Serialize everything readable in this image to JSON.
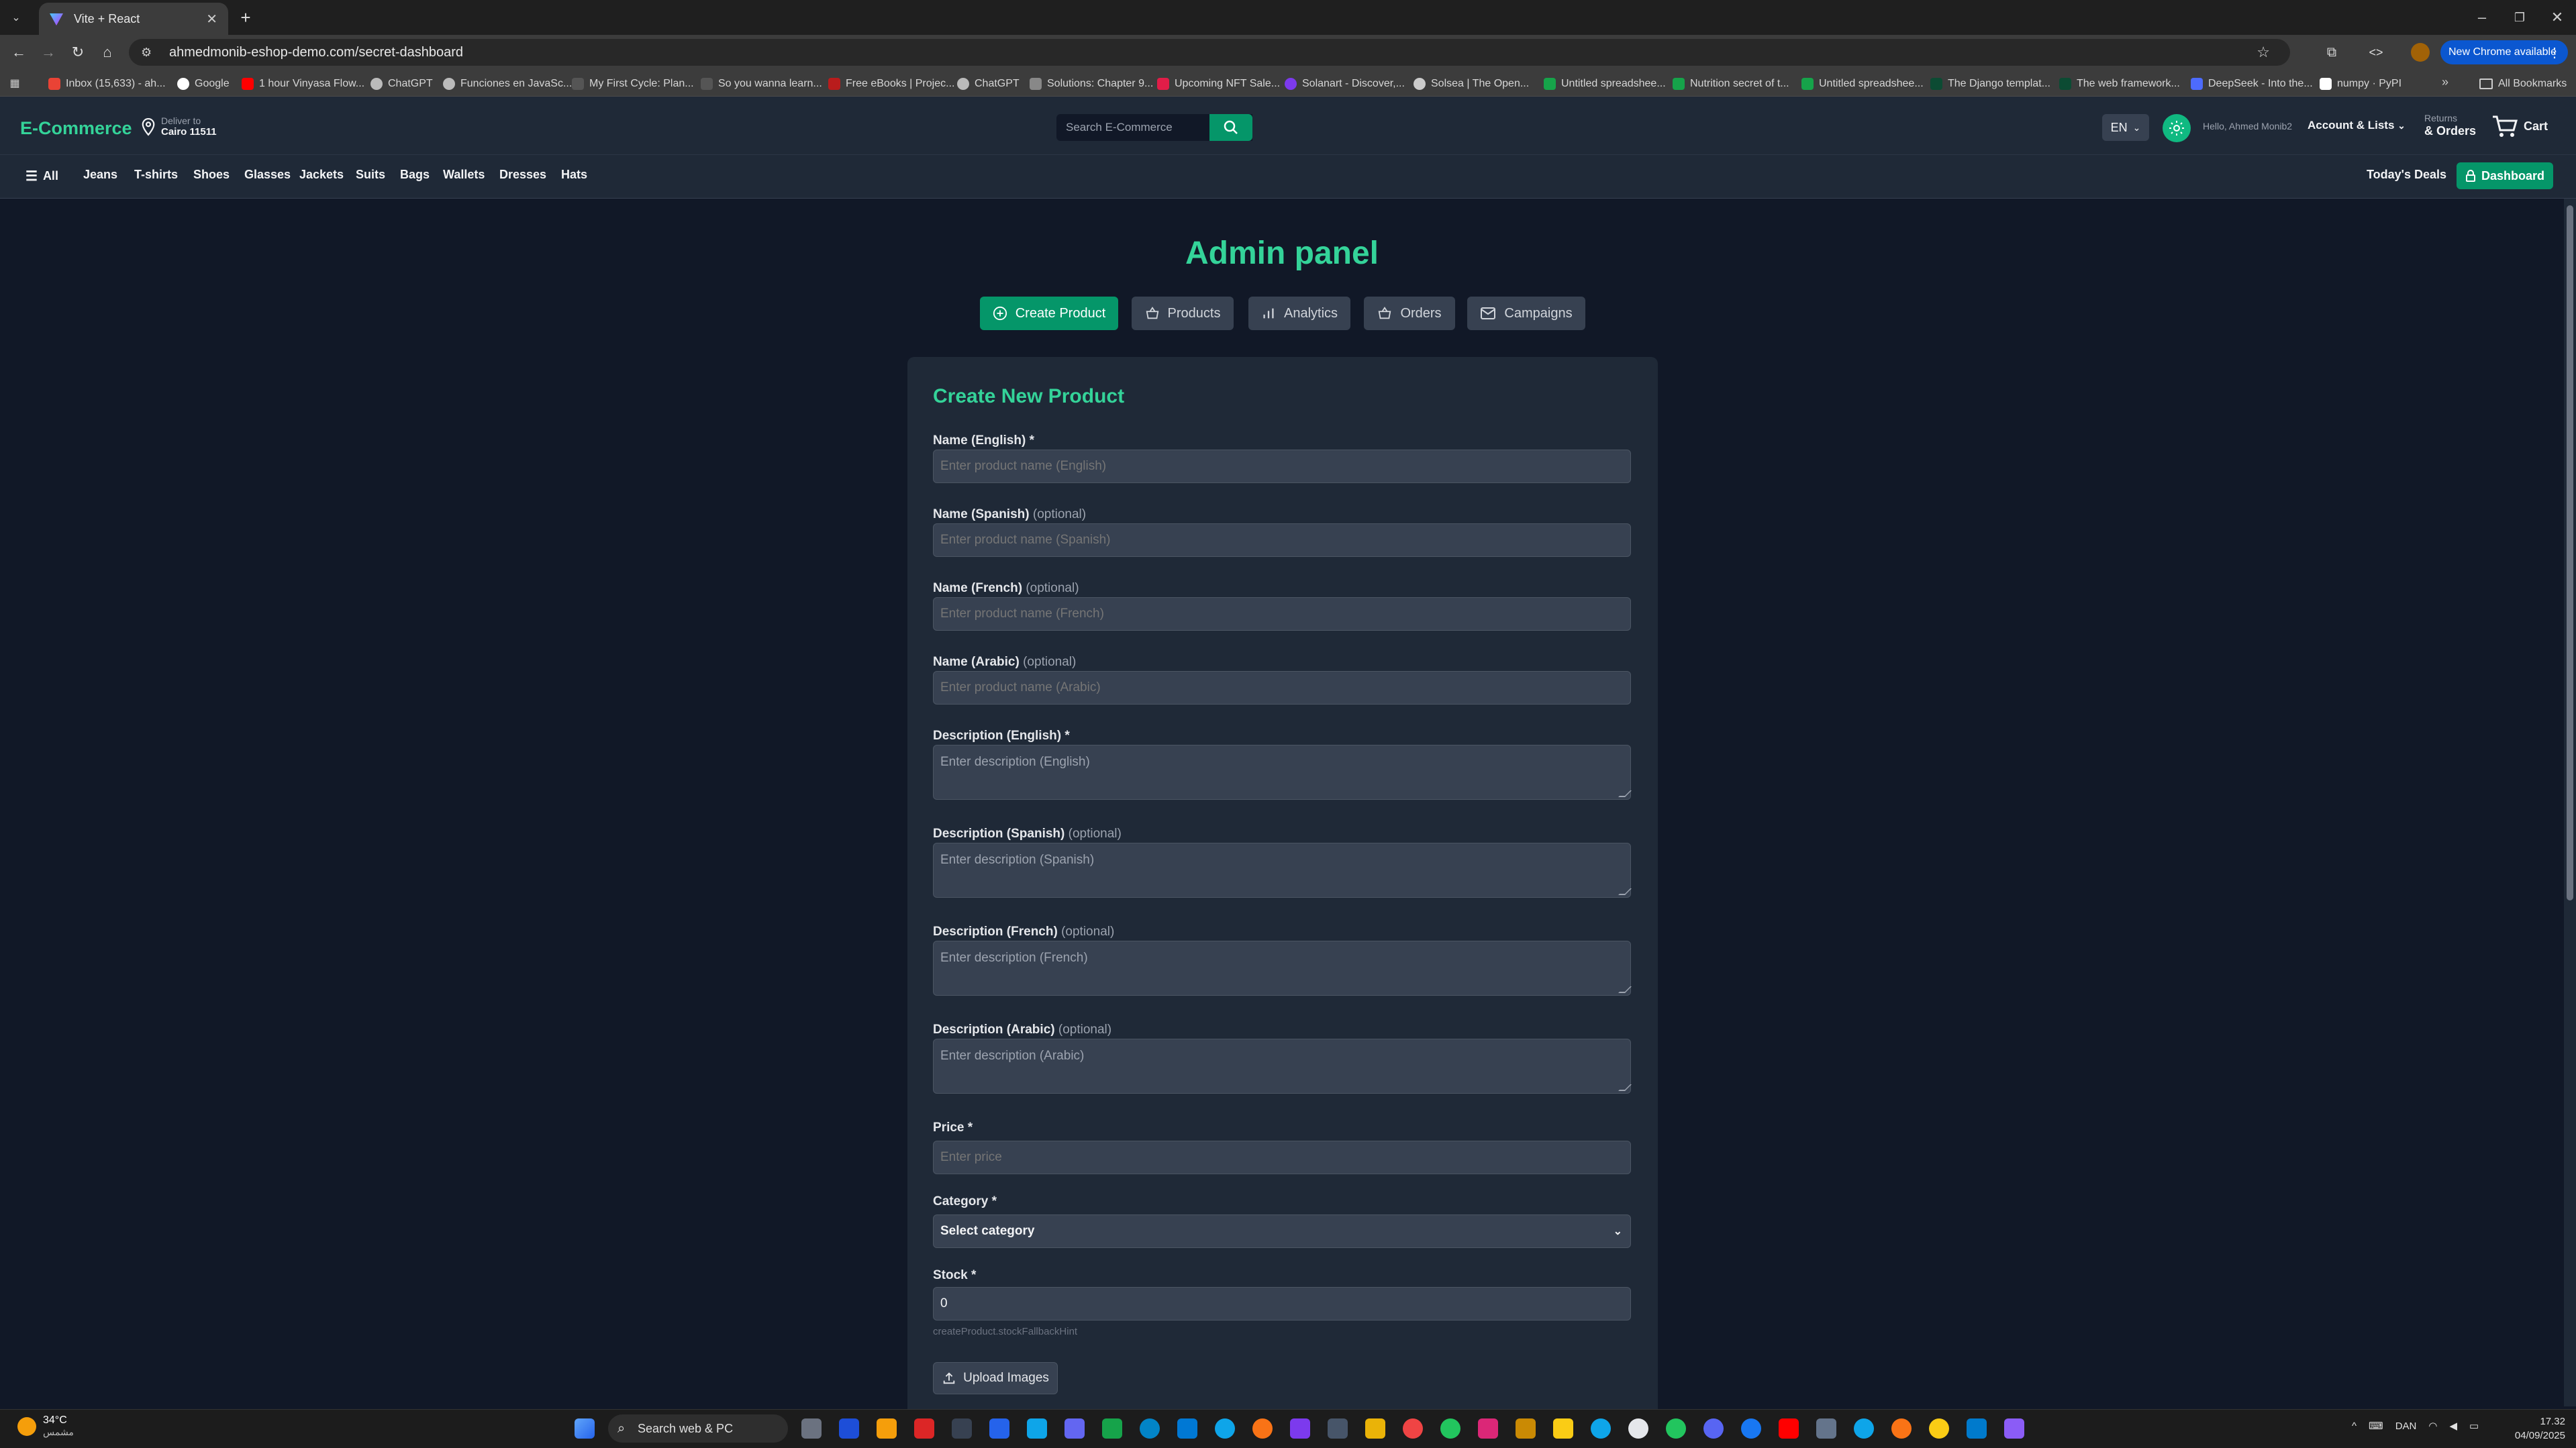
{
  "browser": {
    "tab_title": "Vite + React",
    "url": "ahmedmonib-eshop-demo.com/secret-dashboard",
    "new_chrome": "New Chrome available",
    "bookmarks": [
      "Inbox (15,633) - ah...",
      "Google",
      "1 hour Vinyasa Flow...",
      "ChatGPT",
      "Funciones en JavaSc...",
      "My First Cycle: Plan...",
      "So you wanna learn...",
      "Free eBooks | Projec...",
      "ChatGPT",
      "Solutions: Chapter 9...",
      "Upcoming NFT Sale...",
      "Solanart - Discover,...",
      "Solsea | The Open...",
      "Untitled spreadshee...",
      "Nutrition secret of t...",
      "Untitled spreadshee...",
      "The Django templat...",
      "The web framework...",
      "DeepSeek - Into the...",
      "numpy · PyPI"
    ],
    "all_bookmarks": "All Bookmarks"
  },
  "header": {
    "logo": "E-Commerce",
    "deliver_to": "Deliver to",
    "location": "Cairo 11511",
    "search_placeholder": "Search E-Commerce",
    "lang": "EN",
    "hello": "Hello, Ahmed Monib2",
    "account": "Account & Lists",
    "returns": "Returns",
    "orders": "& Orders",
    "cart": "Cart"
  },
  "nav": {
    "all": "All",
    "categories": [
      "Jeans",
      "T-shirts",
      "Shoes",
      "Glasses",
      "Jackets",
      "Suits",
      "Bags",
      "Wallets",
      "Dresses",
      "Hats"
    ],
    "deals": "Today's Deals",
    "dashboard": "Dashboard"
  },
  "admin": {
    "title": "Admin panel",
    "tabs": [
      "Create Product",
      "Products",
      "Analytics",
      "Orders",
      "Campaigns"
    ]
  },
  "form": {
    "title": "Create New Product",
    "optional": "(optional)",
    "name_en": {
      "label": "Name (English) *",
      "placeholder": "Enter product name (English)"
    },
    "name_es": {
      "label": "Name (Spanish)",
      "placeholder": "Enter product name (Spanish)"
    },
    "name_fr": {
      "label": "Name (French)",
      "placeholder": "Enter product name (French)"
    },
    "name_ar": {
      "label": "Name (Arabic)",
      "placeholder": "Enter product name (Arabic)"
    },
    "desc_en": {
      "label": "Description (English) *",
      "placeholder": "Enter description (English)"
    },
    "desc_es": {
      "label": "Description (Spanish)",
      "placeholder": "Enter description (Spanish)"
    },
    "desc_fr": {
      "label": "Description (French)",
      "placeholder": "Enter description (French)"
    },
    "desc_ar": {
      "label": "Description (Arabic)",
      "placeholder": "Enter description (Arabic)"
    },
    "price": {
      "label": "Price *",
      "placeholder": "Enter price"
    },
    "category": {
      "label": "Category *",
      "value": "Select category"
    },
    "stock": {
      "label": "Stock *",
      "value": "0"
    },
    "stock_hint": "createProduct.stockFallbackHint",
    "upload": "Upload Images"
  },
  "taskbar": {
    "temp": "34°C",
    "condition": "مشمس",
    "search": "Search web & PC",
    "lang": "DAN",
    "time": "17.32",
    "date": "04/09/2025"
  },
  "colors": {
    "accent": "#059669",
    "title_green": "#34d399",
    "bg": "#111827",
    "panel": "#1f2937",
    "input": "#374151"
  }
}
